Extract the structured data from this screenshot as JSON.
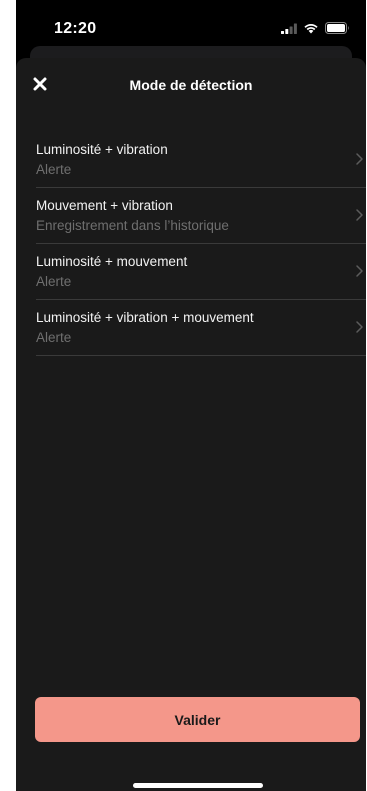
{
  "status_bar": {
    "time": "12:20",
    "icons": [
      "cellular-signal-icon",
      "wifi-icon",
      "battery-icon"
    ]
  },
  "header": {
    "close_icon": "close-icon",
    "title": "Mode de détection"
  },
  "options": [
    {
      "title": "Luminosité + vibration",
      "subtitle": "Alerte"
    },
    {
      "title": "Mouvement + vibration",
      "subtitle": "Enregistrement dans l’historique"
    },
    {
      "title": "Luminosité + mouvement",
      "subtitle": "Alerte"
    },
    {
      "title": "Luminosité + vibration + mouvement",
      "subtitle": "Alerte"
    }
  ],
  "footer": {
    "validate_label": "Valider"
  },
  "colors": {
    "background": "#000000",
    "sheet": "#1a1a1a",
    "accent": "#f4978a",
    "divider": "#3a3a3a",
    "subtitle": "#6f6f6f"
  }
}
